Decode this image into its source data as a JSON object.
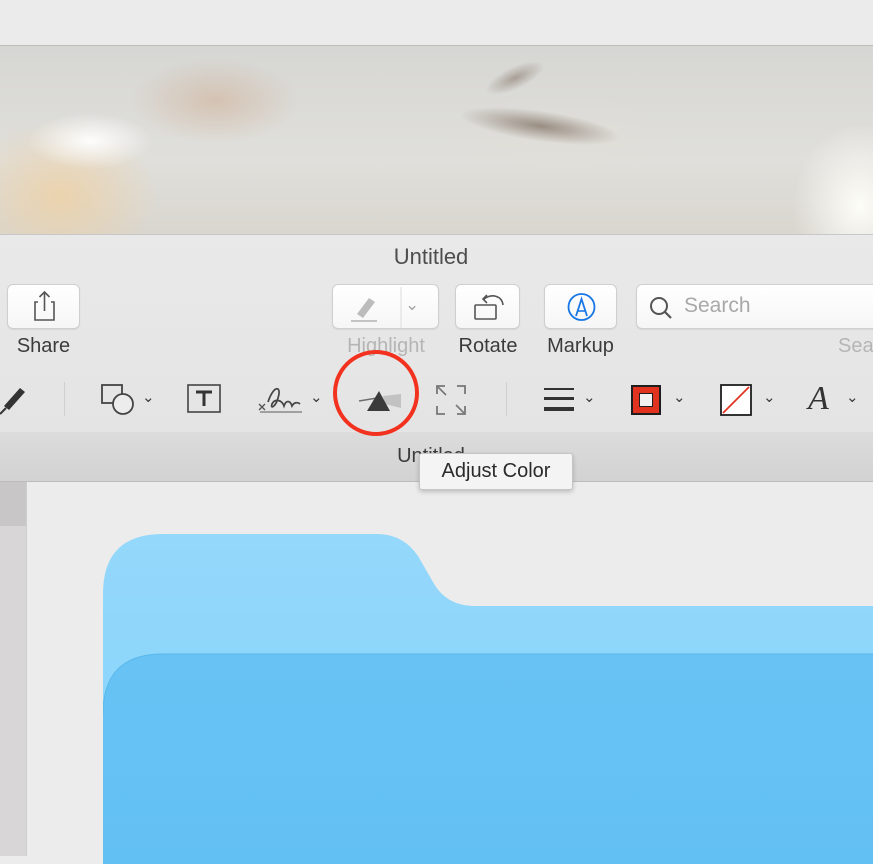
{
  "window": {
    "title": "Untitled",
    "tab_title": "Untitled"
  },
  "toolbar": {
    "share_label": "Share",
    "highlight_label": "Highlight",
    "rotate_label": "Rotate",
    "markup_label": "Markup",
    "search_placeholder": "Search",
    "search_label": "Sea"
  },
  "markup_tools": [
    {
      "name": "sketch",
      "icon": "pen-icon"
    },
    {
      "name": "shapes",
      "icon": "shapes-icon",
      "has_menu": true
    },
    {
      "name": "text",
      "icon": "text-box-icon"
    },
    {
      "name": "sign",
      "icon": "signature-icon",
      "has_menu": true
    },
    {
      "name": "adjust-color",
      "icon": "prism-icon",
      "highlighted": true
    },
    {
      "name": "adjust-size",
      "icon": "resize-icon"
    },
    {
      "name": "shape-style",
      "icon": "lines-icon",
      "has_menu": true
    },
    {
      "name": "border-color",
      "icon": "border-color-icon",
      "has_menu": true
    },
    {
      "name": "fill-color",
      "icon": "fill-color-icon",
      "has_menu": true
    },
    {
      "name": "text-style",
      "icon": "font-icon",
      "has_menu": true
    }
  ],
  "tooltip": {
    "text": "Adjust Color"
  },
  "colors": {
    "annotation_circle": "#f2311e",
    "border_color_swatch": "#e1331f",
    "markup_icon_blue": "#1877e6",
    "folder_front": "#67c4f5",
    "folder_back": "#8fd6fb"
  }
}
